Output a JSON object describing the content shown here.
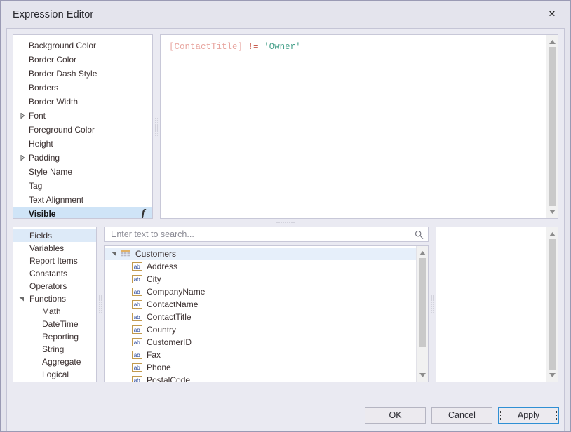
{
  "window": {
    "title": "Expression Editor",
    "close_label": "✕"
  },
  "properties": {
    "items": [
      {
        "label": "Background Color",
        "expandable": false,
        "selected": false,
        "fx": false
      },
      {
        "label": "Border Color",
        "expandable": false,
        "selected": false,
        "fx": false
      },
      {
        "label": "Border Dash Style",
        "expandable": false,
        "selected": false,
        "fx": false
      },
      {
        "label": "Borders",
        "expandable": false,
        "selected": false,
        "fx": false
      },
      {
        "label": "Border Width",
        "expandable": false,
        "selected": false,
        "fx": false
      },
      {
        "label": "Font",
        "expandable": true,
        "selected": false,
        "fx": false
      },
      {
        "label": "Foreground Color",
        "expandable": false,
        "selected": false,
        "fx": false
      },
      {
        "label": "Height",
        "expandable": false,
        "selected": false,
        "fx": false
      },
      {
        "label": "Padding",
        "expandable": true,
        "selected": false,
        "fx": false
      },
      {
        "label": "Style Name",
        "expandable": false,
        "selected": false,
        "fx": false
      },
      {
        "label": "Tag",
        "expandable": false,
        "selected": false,
        "fx": false
      },
      {
        "label": "Text Alignment",
        "expandable": false,
        "selected": false,
        "fx": false
      },
      {
        "label": "Visible",
        "expandable": false,
        "selected": true,
        "fx": true,
        "fx_glyph": "f"
      }
    ]
  },
  "editor": {
    "expression": "[ContactTitle] != 'Owner'",
    "tokens": [
      {
        "text": "[ContactTitle]",
        "type": "field"
      },
      {
        "text": " ",
        "type": "plain"
      },
      {
        "text": "!=",
        "type": "op"
      },
      {
        "text": " ",
        "type": "plain"
      },
      {
        "text": "'Owner'",
        "type": "string"
      }
    ],
    "colors": {
      "field": "#e8a6a0",
      "operator": "#c75c4e",
      "string": "#46a08a"
    }
  },
  "categories": {
    "items": [
      {
        "label": "Fields",
        "selected": true,
        "expander": "none",
        "indent": false
      },
      {
        "label": "Variables",
        "selected": false,
        "expander": "none",
        "indent": false
      },
      {
        "label": "Report Items",
        "selected": false,
        "expander": "none",
        "indent": false
      },
      {
        "label": "Constants",
        "selected": false,
        "expander": "none",
        "indent": false
      },
      {
        "label": "Operators",
        "selected": false,
        "expander": "none",
        "indent": false
      },
      {
        "label": "Functions",
        "selected": false,
        "expander": "expanded",
        "indent": false
      },
      {
        "label": "Math",
        "selected": false,
        "expander": "none",
        "indent": true
      },
      {
        "label": "DateTime",
        "selected": false,
        "expander": "none",
        "indent": true
      },
      {
        "label": "Reporting",
        "selected": false,
        "expander": "none",
        "indent": true
      },
      {
        "label": "String",
        "selected": false,
        "expander": "none",
        "indent": true
      },
      {
        "label": "Aggregate",
        "selected": false,
        "expander": "none",
        "indent": true
      },
      {
        "label": "Logical",
        "selected": false,
        "expander": "none",
        "indent": true
      }
    ]
  },
  "search": {
    "value": "",
    "placeholder": "Enter text to search...",
    "icon": "search-icon"
  },
  "field_tree": {
    "root": {
      "label": "Customers",
      "icon": "table-icon",
      "expanded": true
    },
    "fields": [
      {
        "label": "Address",
        "icon": "ab-icon"
      },
      {
        "label": "City",
        "icon": "ab-icon"
      },
      {
        "label": "CompanyName",
        "icon": "ab-icon"
      },
      {
        "label": "ContactName",
        "icon": "ab-icon"
      },
      {
        "label": "ContactTitle",
        "icon": "ab-icon"
      },
      {
        "label": "Country",
        "icon": "ab-icon"
      },
      {
        "label": "CustomerID",
        "icon": "ab-icon"
      },
      {
        "label": "Fax",
        "icon": "ab-icon"
      },
      {
        "label": "Phone",
        "icon": "ab-icon"
      },
      {
        "label": "PostalCode",
        "icon": "ab-icon"
      }
    ]
  },
  "description_panel": {
    "text": ""
  },
  "footer": {
    "ok_label": "OK",
    "cancel_label": "Cancel",
    "apply_label": "Apply",
    "focused_button": "Apply",
    "focus_color": "#2f8fd4"
  },
  "theme": {
    "window_bg": "#e4e4ed",
    "client_bg": "#eaeaf2",
    "panel_bg": "#ffffff",
    "border": "#c8c8d8",
    "selection_blue": "#cfe4f7",
    "tree_selection": "#e6effa"
  }
}
